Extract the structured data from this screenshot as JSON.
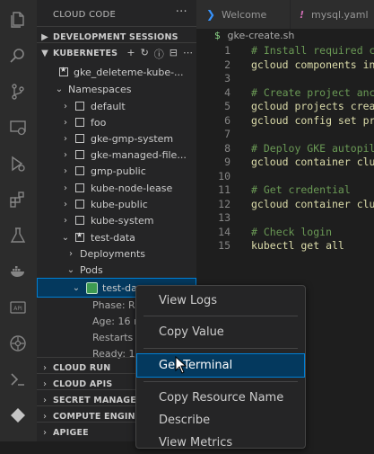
{
  "sidebar": {
    "title": "CLOUD CODE",
    "more": "···",
    "dev_sessions": "DEVELOPMENT SESSIONS",
    "kubernetes": "KUBERNETES",
    "cluster": "gke_deleteme-kube-...",
    "namespaces_label": "Namespaces",
    "namespaces": [
      "default",
      "foo",
      "gke-gmp-system",
      "gke-managed-file...",
      "gmp-public",
      "kube-node-lease",
      "kube-public",
      "kube-system"
    ],
    "active_namespace": "test-data",
    "deployments": "Deployments",
    "pods": "Pods",
    "pod_name": "test-da",
    "pod_details": [
      "Phase: R",
      "Age: 16 m",
      "Restarts",
      "Ready: 1/"
    ],
    "sections_bottom": [
      "CLOUD RUN",
      "CLOUD APIS",
      "SECRET MANAGER",
      "COMPUTE ENGINE",
      "APIGEE"
    ]
  },
  "tabs": [
    {
      "label": "Welcome",
      "icon": "vscode-icon"
    },
    {
      "label": "mysql.yaml",
      "icon": "yaml-icon"
    }
  ],
  "breadcrumb": "gke-create.sh",
  "breadcrumb_icon": "$",
  "code": [
    {
      "n": "1",
      "t": "# Install required c",
      "k": "comment"
    },
    {
      "n": "2",
      "t": "gcloud components in",
      "k": "cmd"
    },
    {
      "n": "3",
      "t": "",
      "k": "comment"
    },
    {
      "n": "4",
      "t": "# Create project anc",
      "k": "comment"
    },
    {
      "n": "5",
      "t": "gcloud projects crea",
      "k": "cmd"
    },
    {
      "n": "6",
      "t": "gcloud config set pr",
      "k": "cmd"
    },
    {
      "n": "7",
      "t": "",
      "k": "comment"
    },
    {
      "n": "8",
      "t": "# Deploy GKE autopil",
      "k": "comment"
    },
    {
      "n": "9",
      "t": "gcloud container clu",
      "k": "cmd"
    },
    {
      "n": "10",
      "t": "",
      "k": "comment"
    },
    {
      "n": "11",
      "t": "# Get credential",
      "k": "comment"
    },
    {
      "n": "12",
      "t": "gcloud container clu",
      "k": "cmd"
    },
    {
      "n": "13",
      "t": "",
      "k": "comment"
    },
    {
      "n": "14",
      "t": "# Check login",
      "k": "comment"
    },
    {
      "n": "15",
      "t": "kubectl get all",
      "k": "cmd"
    }
  ],
  "context_menu": [
    "View Logs",
    "Copy Value",
    "Get Terminal",
    "Copy Resource Name",
    "Describe",
    "View Metrics"
  ],
  "colors": {
    "accent": "#007fd4",
    "selection": "#04395e"
  }
}
